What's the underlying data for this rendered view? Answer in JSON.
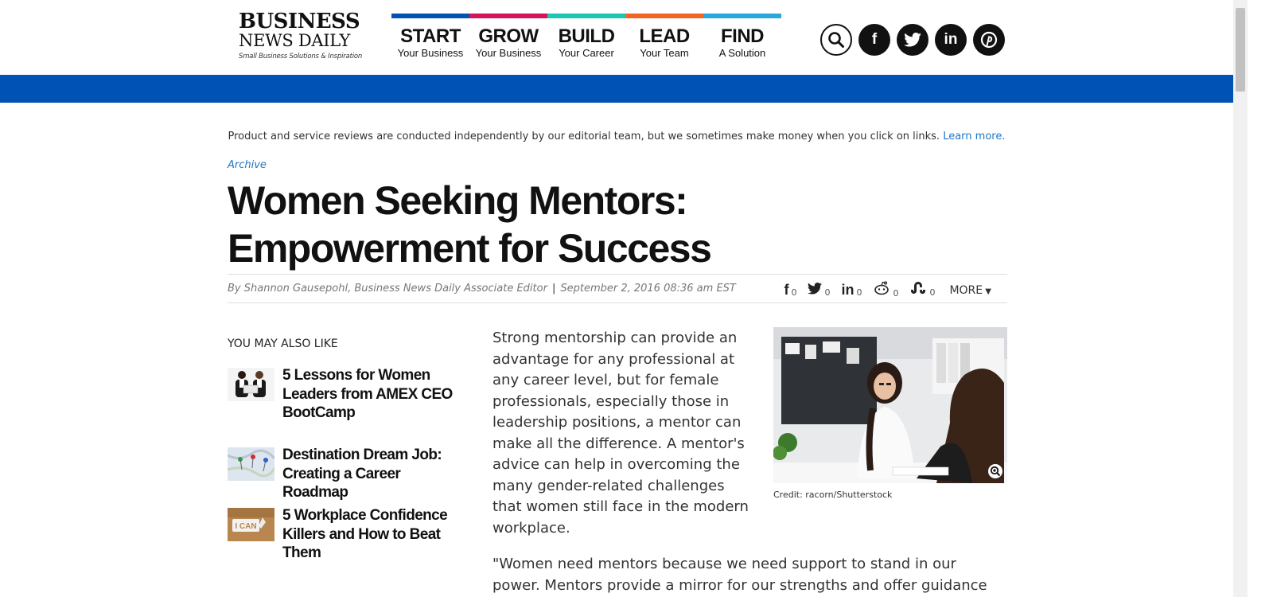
{
  "logo": {
    "line1": "BUSINESS",
    "line2": "NEWS DAILY",
    "tagline": "Small Business Solutions & Inspiration"
  },
  "nav": [
    {
      "big": "START",
      "small": "Your Business",
      "color": "#0052b4"
    },
    {
      "big": "GROW",
      "small": "Your Business",
      "color": "#d4145a"
    },
    {
      "big": "BUILD",
      "small": "Your Career",
      "color": "#1bc7b4"
    },
    {
      "big": "LEAD",
      "small": "Your Team",
      "color": "#f26522"
    },
    {
      "big": "FIND",
      "small": "A Solution",
      "color": "#29a8e0"
    }
  ],
  "social": {
    "search": "search-icon",
    "facebook": "f",
    "twitter": "twitter-icon",
    "linkedin": "in",
    "pinterest": "P"
  },
  "colors": {
    "brand_blue": "#0052b4",
    "link": "#1f77c6"
  },
  "disclaimer": {
    "text": "Product and service reviews are conducted independently by our editorial team, but we sometimes make money when you click on links.",
    "link": "Learn more."
  },
  "article": {
    "category": "Archive",
    "title": "Women Seeking Mentors: Empowerment for Success",
    "author": "By Shannon Gausepohl, Business News Daily Associate Editor",
    "separator": "|",
    "date": "September 2, 2016 08:36 am EST",
    "paragraph1": "Strong mentorship can provide an advantage for any professional at any career level, but for female professionals, especially those in leadership positions, a mentor can make all the difference. A mentor's advice can help in overcoming the many gender-related challenges that women still face in the modern workplace.",
    "paragraph2": "\"Women need mentors because we need support to stand in our power. Mentors provide a mirror for our strengths and offer guidance toward",
    "image_credit": "Credit: racorn/Shutterstock"
  },
  "shares": {
    "facebook": "0",
    "twitter": "0",
    "linkedin": "0",
    "reddit": "0",
    "stumbleupon": "0",
    "more": "MORE"
  },
  "related": {
    "heading": "YOU MAY ALSO LIKE",
    "items": [
      {
        "title": "5 Lessons for Women Leaders from AMEX CEO BootCamp"
      },
      {
        "title": "Destination Dream Job: Creating a Career Roadmap"
      },
      {
        "title": "5 Workplace Confidence Killers and How to Beat Them",
        "thumb_text": "I CAN"
      }
    ]
  }
}
